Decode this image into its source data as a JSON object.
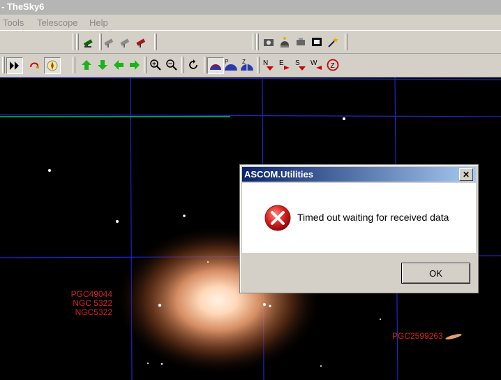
{
  "window": {
    "title": "- TheSky6"
  },
  "menubar": {
    "items": [
      {
        "label": "Tools"
      },
      {
        "label": "Telescope"
      },
      {
        "label": "Help"
      }
    ]
  },
  "toolbar2": {
    "compass": {
      "n": "N",
      "e": "E",
      "s": "S",
      "w": "W",
      "z": "Z"
    },
    "orientation": {
      "p": "P",
      "z": "Z"
    }
  },
  "sky": {
    "labels": [
      {
        "text": "PGC49044"
      },
      {
        "text": "NGC 5322"
      },
      {
        "text": "NGC5322"
      },
      {
        "text": "PGC2599263"
      }
    ]
  },
  "dialog": {
    "title": "ASCOM.Utilities",
    "close_glyph": "✕",
    "message": "Timed out waiting for received data",
    "ok_label": "OK",
    "icon": "error-icon"
  },
  "colors": {
    "grid": "#2222cc",
    "horizon": "#00cc66",
    "label": "#d42020",
    "dialog_title_start": "#0a246a",
    "dialog_title_end": "#a6caf0"
  }
}
